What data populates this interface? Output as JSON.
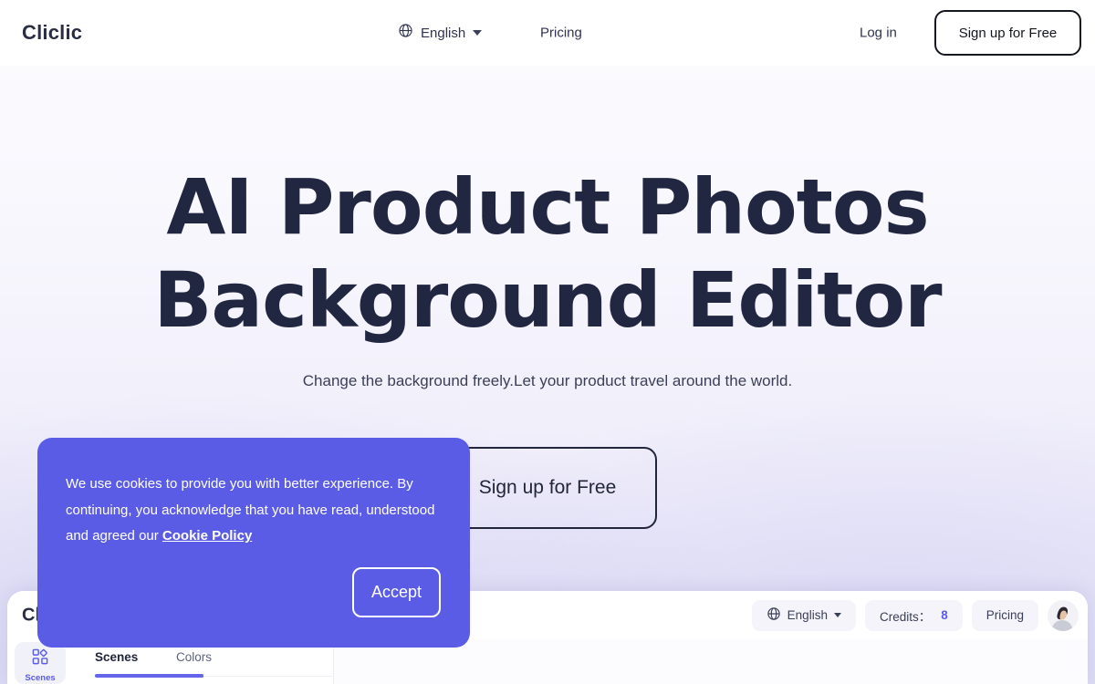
{
  "site": {
    "brand": "Cliclic"
  },
  "topnav": {
    "language": {
      "icon": "globe-icon",
      "label": "English"
    },
    "pricing_label": "Pricing",
    "login_label": "Log in",
    "signup_label": "Sign up for Free"
  },
  "hero": {
    "title_line1": "AI Product Photos",
    "title_line2": "Background Editor",
    "subtitle": "Change the background freely.Let your product travel around the world.",
    "cta_label": "Sign up for Free"
  },
  "cookie_banner": {
    "text_before_link": "We use cookies to provide you with better experience. By continuing, you acknowledge that you have read, understood and agreed our ",
    "link_label": "Cookie Policy",
    "accept_label": "Accept",
    "background_color": "#5b5ce5"
  },
  "app_panel": {
    "brand": "Cliclic",
    "language": {
      "icon": "globe-icon",
      "label": "English"
    },
    "credits": {
      "label": "Credits：",
      "value": "8",
      "value_color": "#5b5ce5"
    },
    "pricing_label": "Pricing",
    "avatar": "user-avatar",
    "rail": [
      {
        "icon": "scenes-grid-icon",
        "label": "Scenes",
        "active": true
      }
    ],
    "tabs": [
      {
        "label": "Scenes",
        "active": true
      },
      {
        "label": "Colors",
        "active": false
      }
    ],
    "accent_color": "#6366ea"
  }
}
